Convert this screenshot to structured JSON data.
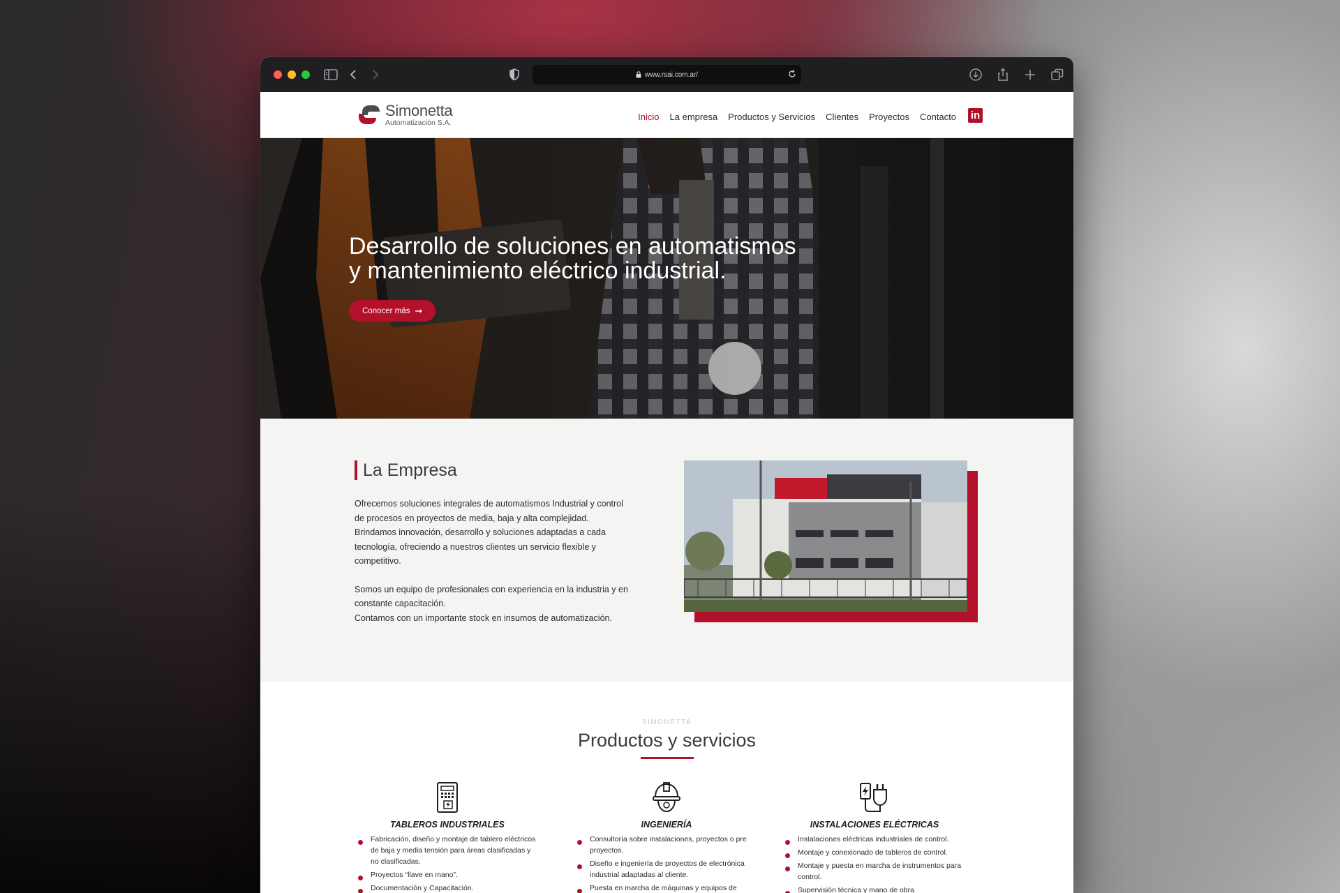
{
  "browser": {
    "url": "www.rsai.com.ar/"
  },
  "header": {
    "logo_name": "Simonetta",
    "logo_sub": "Automatización S.A.",
    "nav": [
      {
        "label": "Inicio",
        "active": true
      },
      {
        "label": "La empresa",
        "active": false
      },
      {
        "label": "Productos y Servicios",
        "active": false
      },
      {
        "label": "Clientes",
        "active": false
      },
      {
        "label": "Proyectos",
        "active": false
      },
      {
        "label": "Contacto",
        "active": false
      }
    ],
    "linkedin_label": "in"
  },
  "hero": {
    "title_line1": "Desarrollo de soluciones en automatismos",
    "title_line2": "y mantenimiento eléctrico industrial.",
    "cta_label": "Conocer más",
    "cta_icon": "arrow-right-icon"
  },
  "empresa": {
    "heading": "La Empresa",
    "paragraph1_lines": [
      "Ofrecemos soluciones integrales de automatismos Industrial y control",
      "de procesos en proyectos de media, baja y alta complejidad.",
      "Brindamos innovación, desarrollo y soluciones adaptadas a cada",
      "tecnología, ofreciendo a nuestros clientes un servicio flexible y",
      "competitivo."
    ],
    "paragraph2_lines": [
      "Somos un equipo de profesionales con experiencia en la industria y en",
      "constante capacitación.",
      "Contamos con un importante stock en insumos de automatización."
    ]
  },
  "services": {
    "eyebrow": "SIMONETTA",
    "title": "Productos y servicios",
    "columns": [
      {
        "title": "TABLEROS INDUSTRIALES",
        "icon": "electrical-panel-icon",
        "items": [
          "Fabricación, diseño y montaje de tablero eléctricos de baja y media tensión para áreas clasificadas y no clasificadas.",
          "Proyectos “llave en mano”.",
          "Documentación y Capacitación."
        ]
      },
      {
        "title": "INGENIERÍA",
        "icon": "engineer-helmet-icon",
        "items": [
          "Consultoría sobre instalaciones, proyectos o pre proyectos.",
          "Diseño e ingeniería de proyectos de electrónica industrial adaptadas al cliente.",
          "Puesta en marcha de máquinas y equipos de"
        ]
      },
      {
        "title": "INSTALACIONES ELÉCTRICAS",
        "icon": "electric-plug-icon",
        "items": [
          "Instalaciones eléctricas industriales de control.",
          "Montaje y conexionado de tableros de control.",
          "Montaje y puesta en marcha de instrumentos para control.",
          "Supervisión técnica y mano de obra"
        ]
      }
    ]
  },
  "colors": {
    "brand_red": "#b3102c",
    "text_dark": "#2c2c30",
    "section_bg": "#f4f4f2"
  }
}
